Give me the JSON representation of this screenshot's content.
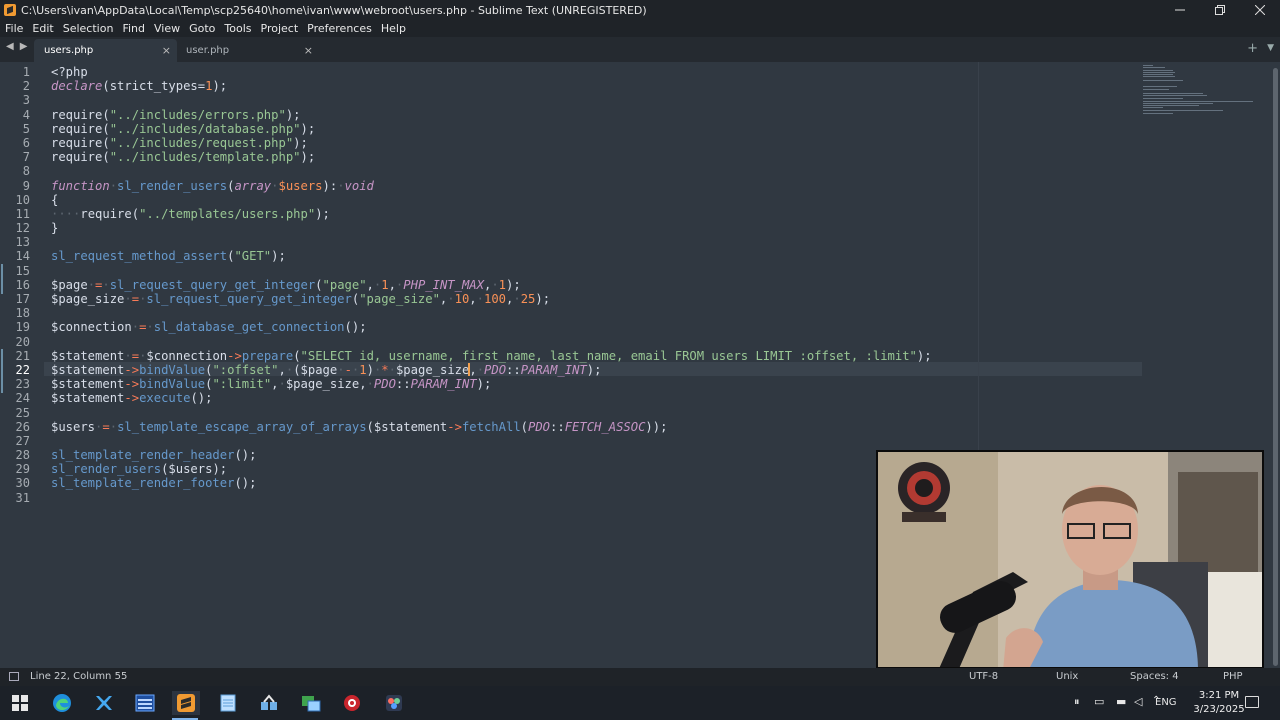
{
  "window": {
    "title": "C:\\Users\\ivan\\AppData\\Local\\Temp\\scp25640\\home\\ivan\\www\\webroot\\users.php - Sublime Text (UNREGISTERED)"
  },
  "menu": [
    "File",
    "Edit",
    "Selection",
    "Find",
    "View",
    "Goto",
    "Tools",
    "Project",
    "Preferences",
    "Help"
  ],
  "tabs": [
    {
      "label": "users.php",
      "active": true
    },
    {
      "label": "user.php",
      "active": false
    }
  ],
  "editor": {
    "current_line": 22,
    "line_numbers": [
      "1",
      "2",
      "3",
      "4",
      "5",
      "6",
      "7",
      "8",
      "9",
      "10",
      "11",
      "12",
      "13",
      "14",
      "15",
      "16",
      "17",
      "18",
      "19",
      "20",
      "21",
      "22",
      "23",
      "24",
      "25",
      "26",
      "27",
      "28",
      "29",
      "30",
      "31"
    ],
    "code": {
      "l1": "<?php",
      "l2_kw": "declare",
      "l2_rest": "(strict_types=",
      "l2_num": "1",
      "l2_end": ");",
      "l4_fn": "require",
      "l4_str": "\"../includes/errors.php\"",
      "l5_str": "\"../includes/database.php\"",
      "l6_str": "\"../includes/request.php\"",
      "l7_str": "\"../includes/template.php\"",
      "l9_kw": "function",
      "l9_fn": "sl_render_users",
      "l9_type": "array",
      "l9_var": "$users",
      "l9_ret": "void",
      "l11_str": "\"../templates/users.php\"",
      "l14_fn": "sl_request_method_assert",
      "l14_str": "\"GET\"",
      "l16_var": "$page",
      "l16_fn": "sl_request_query_get_integer",
      "l16_str": "\"page\"",
      "l16_n1": "1",
      "l16_const": "PHP_INT_MAX",
      "l16_n2": "1",
      "l17_var": "$page_size",
      "l17_str": "\"page_size\"",
      "l17_n1": "10",
      "l17_n2": "100",
      "l17_n3": "25",
      "l19_var": "$connection",
      "l19_fn": "sl_database_get_connection",
      "l21_var": "$statement",
      "l21_method": "prepare",
      "l21_sql": "\"SELECT id, username, first_name, last_name, email FROM users LIMIT :offset, :limit\"",
      "l22_method": "bindValue",
      "l22_str": "\":offset\"",
      "l22_class": "PDO",
      "l22_const": "PARAM_INT",
      "l23_str": "\":limit\"",
      "l24_method": "execute",
      "l26_var": "$users",
      "l26_fn": "sl_template_escape_array_of_arrays",
      "l26_method": "fetchAll",
      "l26_const": "FETCH_ASSOC",
      "l28_fn": "sl_template_render_header",
      "l29_fn": "sl_render_users",
      "l30_fn": "sl_template_render_footer"
    }
  },
  "status": {
    "position": "Line 22, Column 55",
    "encoding": "UTF-8",
    "line_endings": "Unix",
    "indent": "Spaces: 4",
    "syntax": "PHP"
  },
  "taskbar": {
    "language": "ENG",
    "time": "3:21 PM",
    "date": "3/23/2025"
  },
  "colors": {
    "editor_bg": "#303841",
    "chrome_bg": "#1f2328",
    "keyword": "#c695c6",
    "function": "#6699cc",
    "string": "#99c794",
    "number": "#f99157"
  },
  "icons": {
    "start": "windows-start-icon",
    "edge": "edge-browser-icon",
    "sublime": "sublime-text-icon"
  }
}
